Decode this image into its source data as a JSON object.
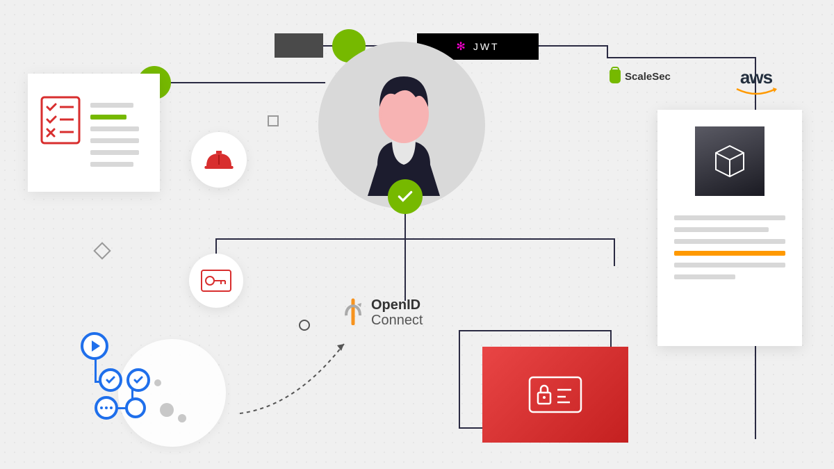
{
  "jwt": {
    "label": "JWT"
  },
  "logos": {
    "scalesec": "ScaleSec",
    "aws": "aws"
  },
  "openid": {
    "line1": "OpenID",
    "line2": "Connect"
  },
  "colors": {
    "green": "#76b900",
    "orange": "#ff9900",
    "red": "#d82e2e",
    "blue": "#1f6feb",
    "dark": "#2a2a42"
  }
}
